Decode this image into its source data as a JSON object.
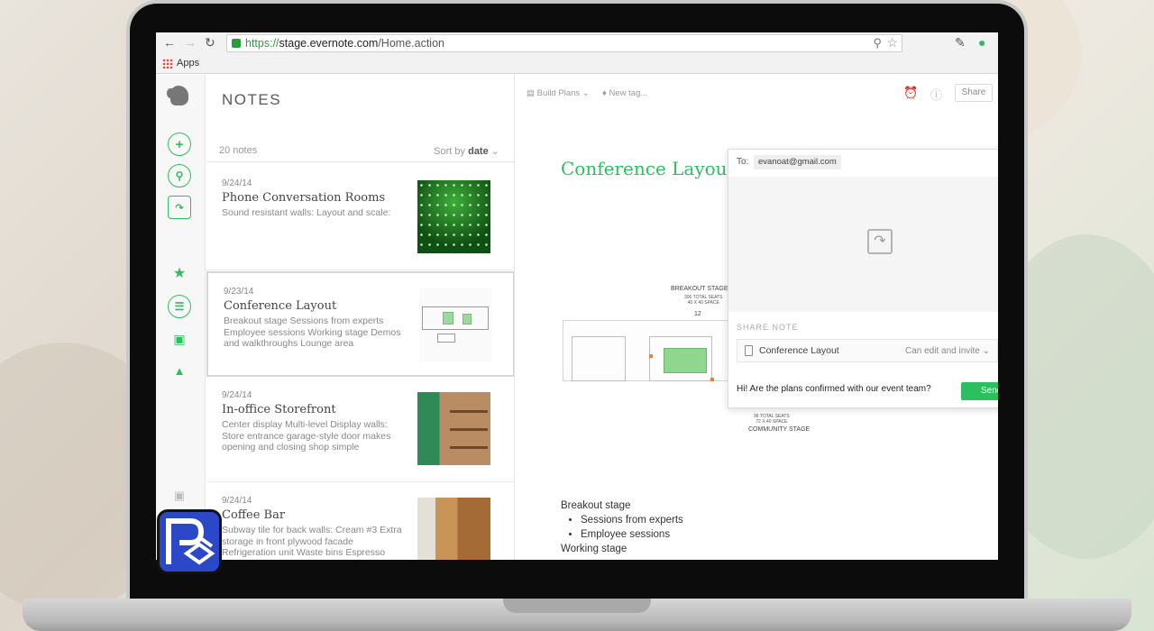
{
  "browser": {
    "url_scheme": "https://",
    "url_host": "stage.evernote.com",
    "url_path": "/Home.action",
    "bookmarks_apps_label": "Apps"
  },
  "notes_panel": {
    "title": "NOTES",
    "count": "20 notes",
    "sort_prefix": "Sort by",
    "sort_value": "date"
  },
  "notes": [
    {
      "date": "9/24/14",
      "title": "Phone Conversation Rooms",
      "snippet": "Sound resistant walls:  Layout and scale:"
    },
    {
      "date": "9/23/14",
      "title": "Conference Layout",
      "snippet": "Breakout stage Sessions from experts Employee sessions Working stage Demos and walkthroughs Lounge area"
    },
    {
      "date": "9/24/14",
      "title": "In-office Storefront",
      "snippet": "Center display Multi-level Display walls: Store entrance garage-style door makes opening and closing shop simple"
    },
    {
      "date": "9/24/14",
      "title": "Coffee Bar",
      "snippet": "Subway tile for back walls: Cream #3 Extra storage in front plywood facade Refrigeration unit Waste bins Espresso"
    }
  ],
  "editor": {
    "notebook": "Build Plans",
    "tag": "New tag...",
    "share_label": "Share",
    "note_title": "Conference Layout",
    "floorplan": {
      "breakout_label": "BREAKOUT STAGE",
      "breakout_sub": "300 TOTAL SEATS\n40 X 40 SPACE",
      "breakout_number": "12",
      "community_label": "COMMUNITY STAGE",
      "community_sub": "96 TOTAL SEATS\n72 X 40 SPACE"
    },
    "body_heading": "Breakout stage",
    "body_bullets": [
      "Sessions from experts",
      "Employee sessions"
    ],
    "body_cutoff": "Working stage"
  },
  "share_popup": {
    "to_label": "To:",
    "recipient": "evanoat@gmail.com",
    "section_label": "SHARE NOTE",
    "note_title": "Conference Layout",
    "permission": "Can edit and invite",
    "message": "Hi! Are the plans confirmed with our event team?",
    "send_label": "Send"
  },
  "colors": {
    "evernote_green": "#2dbe60",
    "badge_blue": "#2b48c8"
  },
  "icons": {
    "sidebar": [
      "new-note-icon",
      "search-icon",
      "work-chat-icon",
      "shortcuts-star-icon",
      "notes-icon",
      "notebooks-icon",
      "tags-icon",
      "market-icon"
    ],
    "editor_toolbar": [
      "reminder-alarm-icon",
      "info-icon"
    ]
  }
}
